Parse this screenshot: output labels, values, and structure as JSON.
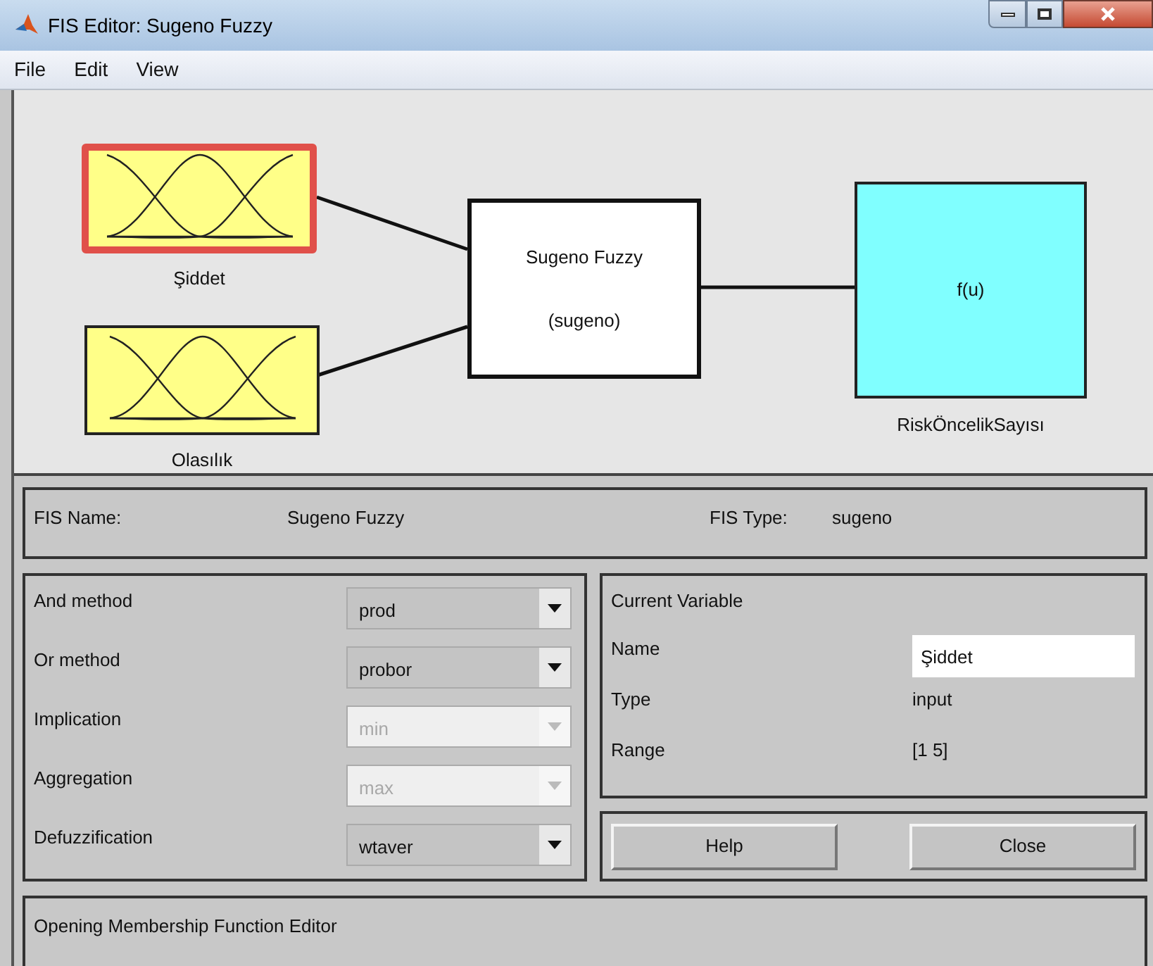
{
  "window": {
    "title": "FIS Editor: Sugeno Fuzzy"
  },
  "menu": [
    "File",
    "Edit",
    "View"
  ],
  "diagram": {
    "inputs": [
      {
        "label": "Şiddet",
        "selected": true
      },
      {
        "label": "Olasılık",
        "selected": false
      }
    ],
    "system": {
      "name": "Sugeno Fuzzy",
      "type": "(sugeno)"
    },
    "outputs": [
      {
        "label": "RiskÖncelikSayısı",
        "function": "f(u)",
        "selected": false
      }
    ]
  },
  "fis": {
    "name_label": "FIS Name:",
    "name": "Sugeno Fuzzy",
    "type_label": "FIS Type:",
    "type": "sugeno"
  },
  "methods": [
    {
      "label": "And method",
      "value": "prod",
      "disabled": false
    },
    {
      "label": "Or method",
      "value": "probor",
      "disabled": false
    },
    {
      "label": "Implication",
      "value": "min",
      "disabled": true
    },
    {
      "label": "Aggregation",
      "value": "max",
      "disabled": true
    },
    {
      "label": "Defuzzification",
      "value": "wtaver",
      "disabled": false
    }
  ],
  "current_variable": {
    "title": "Current Variable",
    "fields": [
      {
        "label": "Name",
        "value": "Şiddet",
        "kind": "input"
      },
      {
        "label": "Type",
        "value": "input",
        "kind": "text"
      },
      {
        "label": "Range",
        "value": "[1 5]",
        "kind": "text"
      }
    ]
  },
  "buttons": [
    "Help",
    "Close"
  ],
  "status": "Opening Membership Function Editor"
}
